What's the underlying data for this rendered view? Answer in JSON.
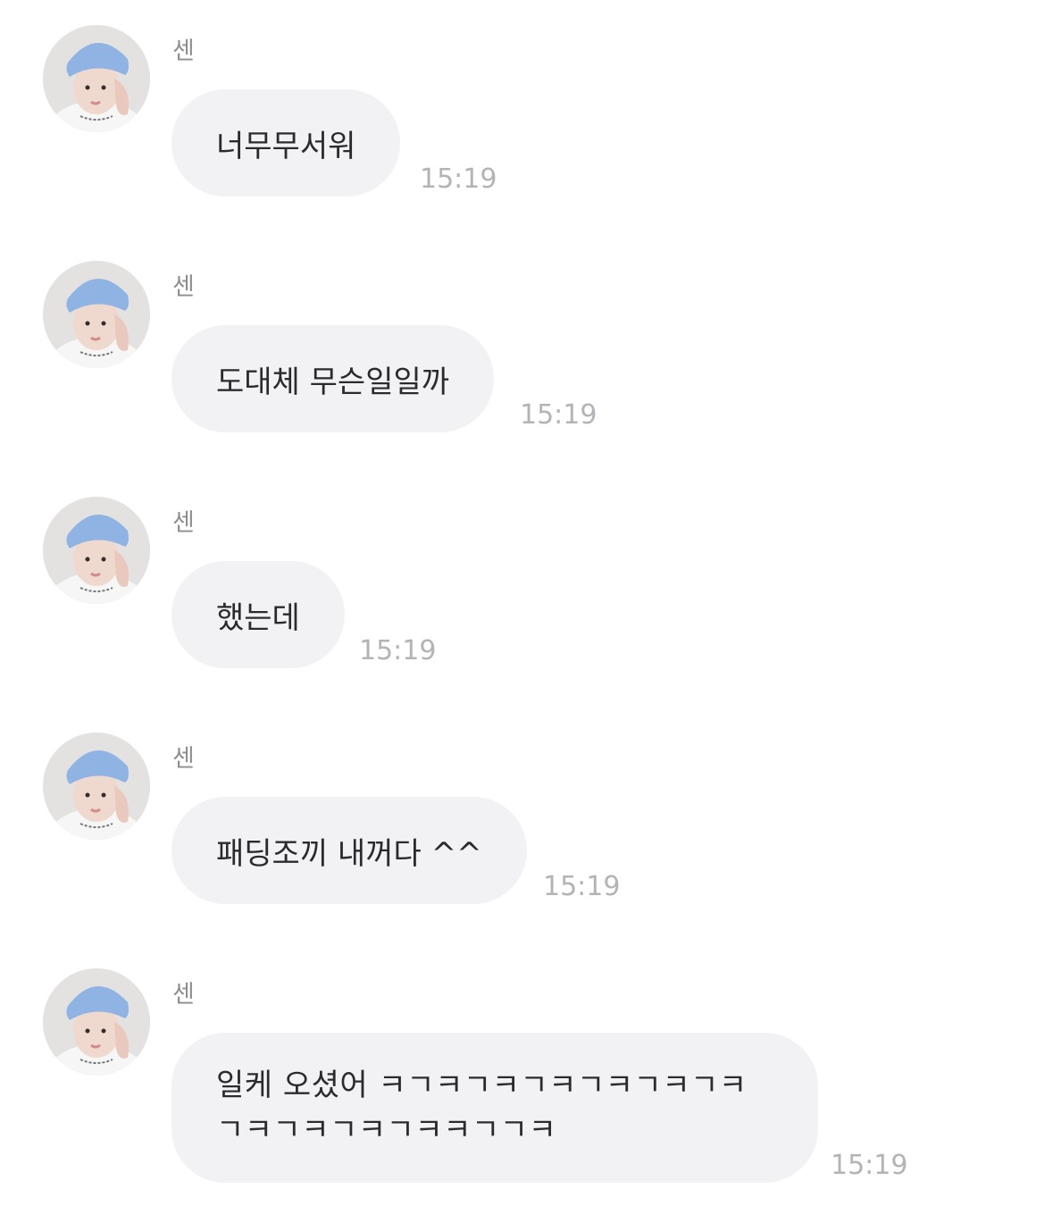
{
  "messages": [
    {
      "sender": "센",
      "text": "너무무서워",
      "time": "15:19"
    },
    {
      "sender": "센",
      "text": "도대체 무슨일일까",
      "time": "15:19"
    },
    {
      "sender": "센",
      "text": "했는데",
      "time": "15:19"
    },
    {
      "sender": "센",
      "text": "패딩조끼 내꺼다 ^^",
      "time": "15:19"
    },
    {
      "sender": "센",
      "text": "일케 오셨어 ㅋㄱㅋㄱㅋㄱㅋㄱㅋㄱㅋㄱㅋ\nㄱㅋㄱㅋㄱㅋㄱㅋㅋㄱㄱㅋ",
      "time": "15:19"
    }
  ],
  "icons": {
    "avatar": "profile-photo-avatar"
  },
  "colors": {
    "bubble": "#f2f2f4",
    "text": "#2b2b2d",
    "sender": "#8e8e93",
    "time": "#b3b3b8",
    "background": "#ffffff"
  }
}
